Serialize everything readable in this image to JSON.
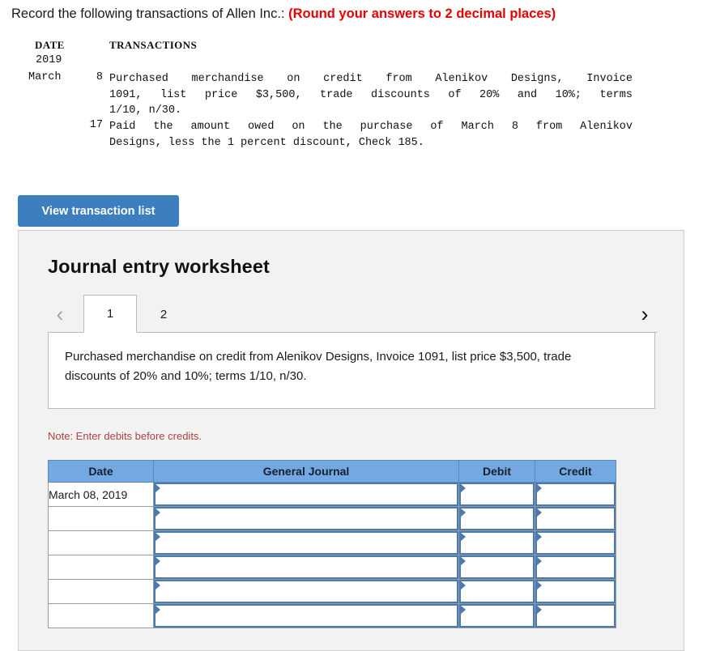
{
  "prompt": {
    "lead": "Record the following transactions of Allen Inc.:",
    "emphasis": "(Round your answers to 2 decimal places)"
  },
  "transactions": {
    "col_date_header": "DATE",
    "col_txn_header": "TRANSACTIONS",
    "year": "2019",
    "month": "March",
    "entries": [
      {
        "day": "8",
        "line1": "Purchased merchandise on credit from Alenikov Designs, Invoice",
        "line2": "1091, list price $3,500, trade discounts of 20% and 10%; terms",
        "line3": "1/10, n/30."
      },
      {
        "day": "17",
        "line1": "Paid the amount owed on the purchase of March 8 from Alenikov",
        "line2": "Designs, less the 1 percent discount, Check 185."
      }
    ]
  },
  "view_button": {
    "label": "View transaction list"
  },
  "worksheet": {
    "title": "Journal entry worksheet",
    "prev_arrow": "‹",
    "next_arrow": "›",
    "tabs": [
      {
        "label": "1",
        "active": true
      },
      {
        "label": "2",
        "active": false
      }
    ],
    "description": "Purchased merchandise on credit from Alenikov Designs, Invoice 1091, list price $3,500, trade discounts of 20% and 10%; terms 1/10, n/30.",
    "note": "Note: Enter debits before credits."
  },
  "journal_table": {
    "headers": [
      "Date",
      "General Journal",
      "Debit",
      "Credit"
    ],
    "rows": [
      {
        "date": "March 08, 2019",
        "general_journal": "",
        "debit": "",
        "credit": ""
      },
      {
        "date": "",
        "general_journal": "",
        "debit": "",
        "credit": ""
      },
      {
        "date": "",
        "general_journal": "",
        "debit": "",
        "credit": ""
      },
      {
        "date": "",
        "general_journal": "",
        "debit": "",
        "credit": ""
      },
      {
        "date": "",
        "general_journal": "",
        "debit": "",
        "credit": ""
      },
      {
        "date": "",
        "general_journal": "",
        "debit": "",
        "credit": ""
      }
    ]
  },
  "colors": {
    "button_blue": "#3d7ebe",
    "table_header_blue": "#74a8e2",
    "emphasis_red": "#e60000",
    "note_red": "#a94442",
    "panel_gray": "#f2f2f2"
  }
}
